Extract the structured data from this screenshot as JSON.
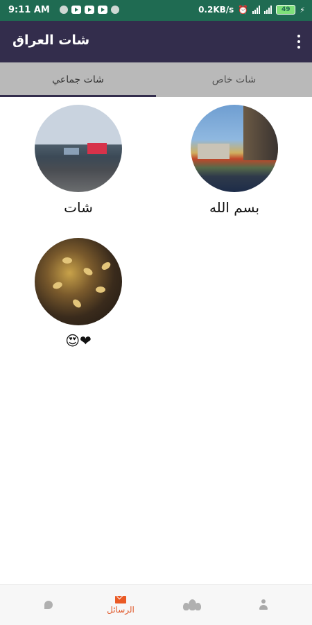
{
  "status_bar": {
    "time": "9:11 AM",
    "speed": "0.2KB/s",
    "battery": "49",
    "icons": [
      "youtube-icon",
      "youtube-icon",
      "youtube-icon",
      "circle-icon",
      "alarm-icon",
      "signal-icon",
      "signal-icon",
      "battery-icon",
      "charging-icon"
    ]
  },
  "app_bar": {
    "title": "شات العراق",
    "menu_icon": "more-vert-icon"
  },
  "tabs": [
    {
      "label": "شات خاص",
      "active": false
    },
    {
      "label": "شات جماعي",
      "active": true
    }
  ],
  "rooms": [
    {
      "name": "بسم الله",
      "image": "city-street-photo"
    },
    {
      "name": "شات",
      "image": "city-square-photo"
    },
    {
      "name": "❤😍",
      "image": "autumn-leaves-photo"
    }
  ],
  "bottom_nav": {
    "items": [
      {
        "icon": "person-icon",
        "label": ""
      },
      {
        "icon": "group-icon",
        "label": ""
      },
      {
        "icon": "mail-icon",
        "label": "الرسائل",
        "active": true
      },
      {
        "icon": "chat-bubble-icon",
        "label": ""
      }
    ]
  },
  "colors": {
    "status_bar": "#1f6b52",
    "app_bar": "#332d4c",
    "tabs_bg": "#b9b9b9",
    "accent": "#ea5a25"
  }
}
